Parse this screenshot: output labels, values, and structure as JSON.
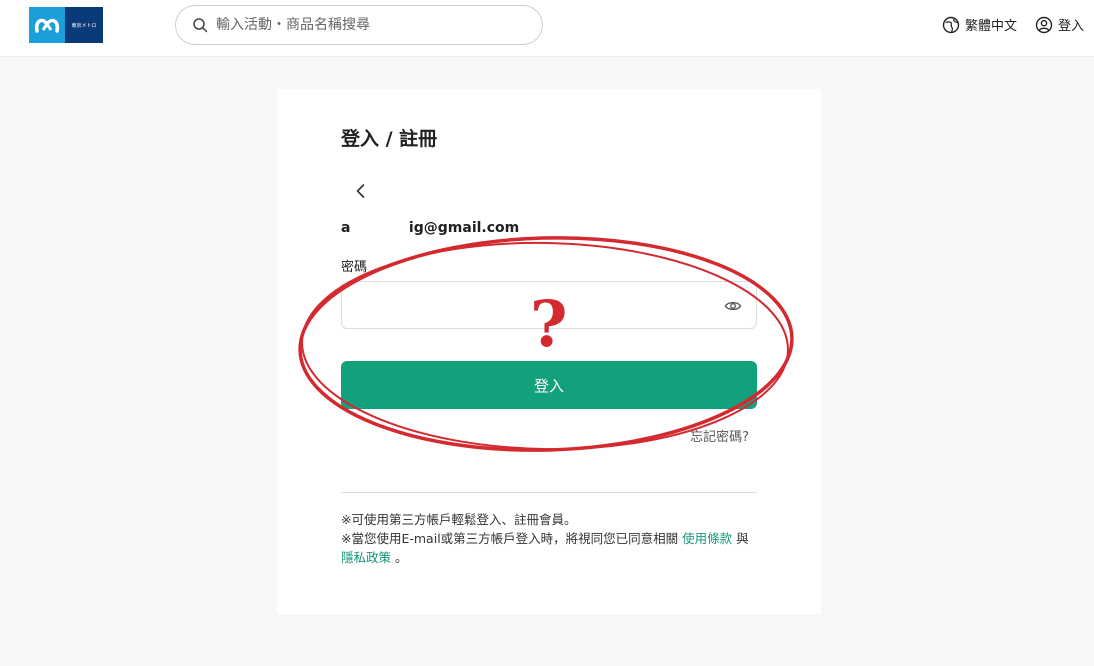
{
  "header": {
    "logo_text": "東京メトロ",
    "search_placeholder": "輸入活動・商品名稱搜尋",
    "language_label": "繁體中文",
    "login_label": "登入"
  },
  "form": {
    "title": "登入 / 註冊",
    "email_display": "a            ig@gmail.com",
    "password_label": "密碼",
    "password_value": "",
    "login_button": "登入",
    "forgot_link": "忘記密碼?"
  },
  "notes": {
    "line1": "※可使用第三方帳戶輕鬆登入、註冊會員。",
    "line2_prefix": "※當您使用E-mail或第三方帳戶登入時，將視同您已同意相關 ",
    "terms_link": "使用條款",
    "conjunction": " 與 ",
    "privacy_link": "隱私政策",
    "suffix": " 。"
  },
  "annotation": {
    "question_mark": "?",
    "color": "#d42a2f"
  },
  "colors": {
    "accent": "#13a07c",
    "brand_light": "#1a9fd8",
    "brand_dark": "#0b3a7a"
  }
}
